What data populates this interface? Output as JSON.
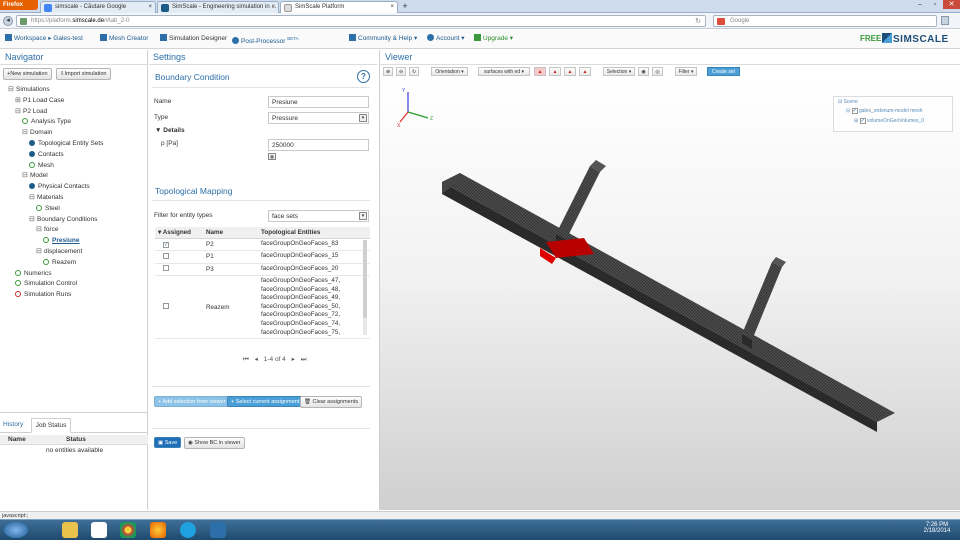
{
  "browser": {
    "app_button": "Firefox",
    "tabs": [
      {
        "label": "simscale - Căutare Google",
        "active": false
      },
      {
        "label": "SimScale - Engineering simulation in ...",
        "active": false
      },
      {
        "label": "SimScale Platform",
        "active": true
      }
    ],
    "url_prefix": "https://platform.",
    "url_host": "simscale.de",
    "url_suffix": "/#tab_2-0",
    "search_placeholder": "Google",
    "new_tab": "+"
  },
  "header": {
    "workspace": "Workspace",
    "project": "Gales-test",
    "mesh_creator": "Mesh Creator",
    "simulation_designer": "Simulation Designer",
    "post_processor": "Post-Processor",
    "beta": "BETA",
    "community": "Community & Help",
    "account": "Account",
    "upgrade": "Upgrade",
    "plan": "FREE",
    "logo": "SIMSCALE"
  },
  "navigator": {
    "title": "Navigator",
    "new_simulation": "New simulation",
    "import_simulation": "Import simulation",
    "tree": [
      {
        "label": "Simulations",
        "icon": "minus",
        "level": 0
      },
      {
        "label": "P1 Load Case",
        "icon": "plus",
        "level": 1
      },
      {
        "label": "P2 Load",
        "icon": "minus",
        "level": 1
      },
      {
        "label": "Analysis Type",
        "icon": "check",
        "level": 2
      },
      {
        "label": "Domain",
        "icon": "minus",
        "level": 2
      },
      {
        "label": "Topological Entity Sets",
        "icon": "dot",
        "level": 3
      },
      {
        "label": "Contacts",
        "icon": "dot",
        "level": 3
      },
      {
        "label": "Mesh",
        "icon": "check",
        "level": 3
      },
      {
        "label": "Model",
        "icon": "minus",
        "level": 2
      },
      {
        "label": "Physical Contacts",
        "icon": "dot",
        "level": 3
      },
      {
        "label": "Materials",
        "icon": "minus",
        "level": 3
      },
      {
        "label": "Steel",
        "icon": "check",
        "level": 4
      },
      {
        "label": "Boundary Conditions",
        "icon": "minus",
        "level": 3
      },
      {
        "label": "force",
        "icon": "minus",
        "level": 4
      },
      {
        "label": "Presiune",
        "icon": "check",
        "level": 5,
        "selected": true
      },
      {
        "label": "displacement",
        "icon": "minus",
        "level": 4
      },
      {
        "label": "Reazem",
        "icon": "check",
        "level": 5
      },
      {
        "label": "Numerics",
        "icon": "check",
        "level": 1
      },
      {
        "label": "Simulation Control",
        "icon": "check",
        "level": 1
      },
      {
        "label": "Simulation Runs",
        "icon": "red",
        "level": 1
      }
    ],
    "bottom_tabs": [
      "History",
      "Job Status"
    ],
    "job_columns": [
      "Name",
      "Status"
    ],
    "empty_text": "no entities available"
  },
  "settings": {
    "title": "Settings",
    "bc_title": "Boundary Condition",
    "help": "?",
    "name_label": "Name",
    "name_value": "Presiune",
    "type_label": "Type",
    "type_value": "Pressure",
    "details_label": "Details",
    "p_label": "p [Pa]",
    "p_value": "250000",
    "topo_title": "Topological Mapping",
    "filter_label": "Filter for entity types",
    "filter_value": "face sets",
    "columns": [
      "Assigned",
      "Name",
      "Topological Entities"
    ],
    "rows": [
      {
        "checked": true,
        "name": "P2",
        "entities": [
          "faceGroupOnGeoFaces_83"
        ]
      },
      {
        "checked": false,
        "name": "P1",
        "entities": [
          "faceGroupOnGeoFaces_15"
        ]
      },
      {
        "checked": false,
        "name": "P3",
        "entities": [
          "faceGroupOnGeoFaces_20"
        ]
      },
      {
        "checked": false,
        "name": "Reazem",
        "entities": [
          "faceGroupOnGeoFaces_47,",
          "faceGroupOnGeoFaces_48,",
          "faceGroupOnGeoFaces_49,",
          "faceGroupOnGeoFaces_50,",
          "faceGroupOnGeoFaces_72,",
          "faceGroupOnGeoFaces_74,",
          "faceGroupOnGeoFaces_75,"
        ]
      }
    ],
    "pager_text": "1-4 of 4",
    "add_selection": "Add selection from viewer",
    "select_current": "Select current assignment",
    "clear_assignments": "Clear assignments",
    "save": "Save",
    "show_bc": "Show BC in viewer"
  },
  "viewer": {
    "title": "Viewer",
    "orientation": "Orientation",
    "surfaces": "surfaces with ed",
    "selection": "Selection",
    "filter": "Filter",
    "create_set": "Create set",
    "scene": {
      "root": "Scene",
      "mesh": "gales_ordenum-model mesh",
      "volume": "volumeOnGeoVolumes_0"
    }
  },
  "status_bar": "javascript:;",
  "taskbar": {
    "time": "7:26 PM",
    "date": "2/18/2014"
  }
}
